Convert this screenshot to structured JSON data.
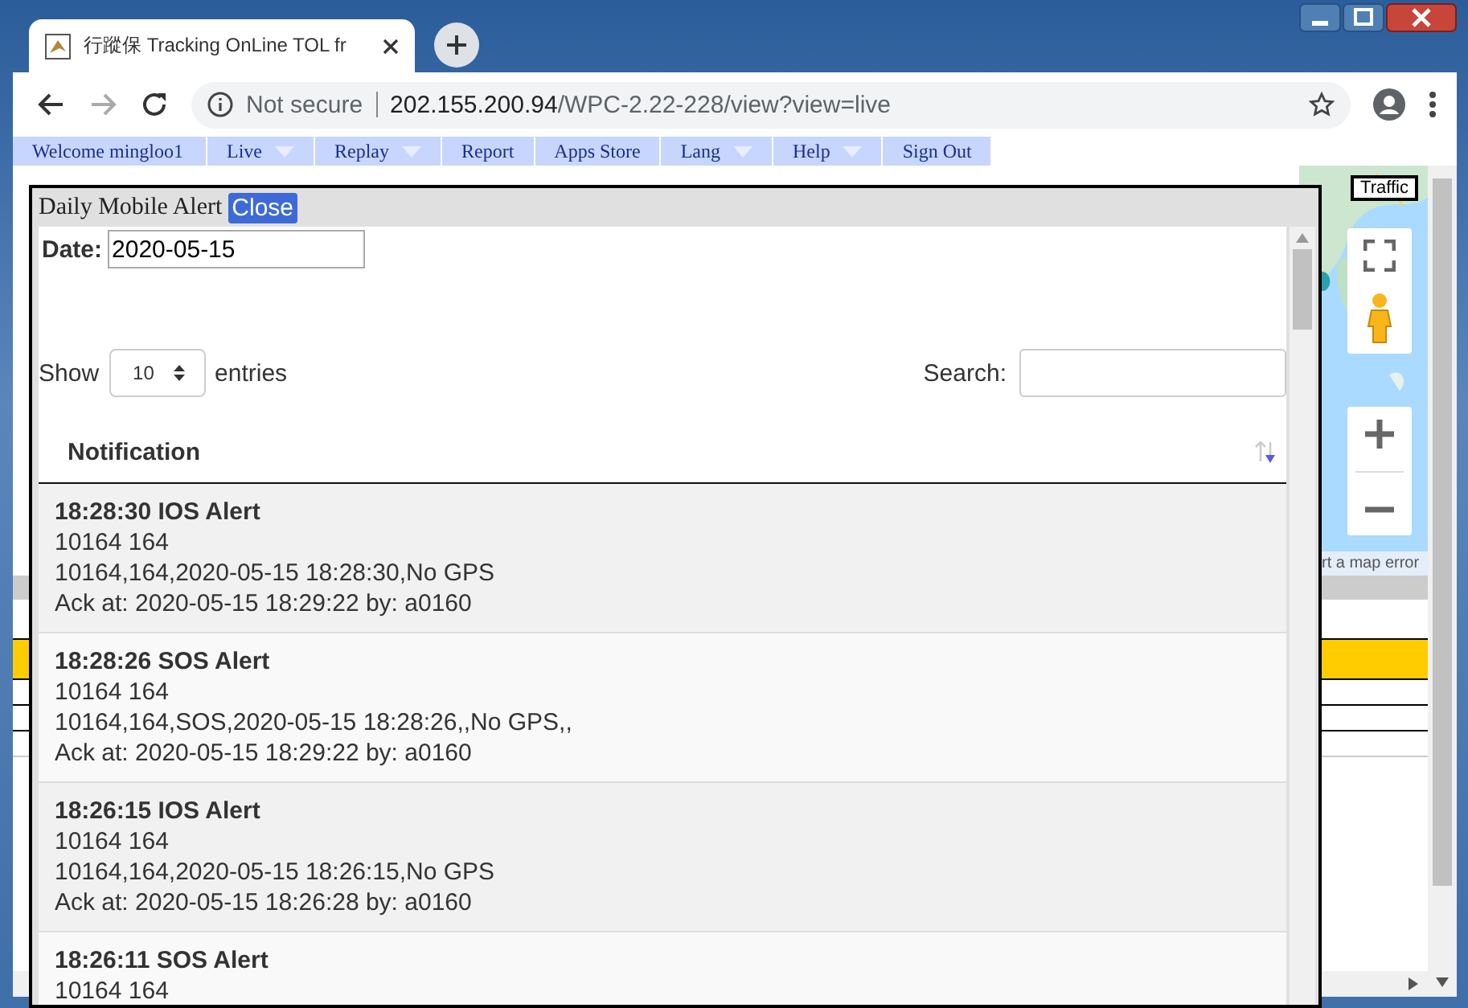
{
  "browser": {
    "tab_title": "行蹤保 Tracking OnLine TOL fr",
    "security": "Not secure",
    "url_host": "202.155.200.94",
    "url_path": "/WPC-2.22-228/view?view=live"
  },
  "menu": [
    {
      "label": "Welcome mingloo1",
      "dropdown": false
    },
    {
      "label": "Live",
      "dropdown": true
    },
    {
      "label": "Replay",
      "dropdown": true
    },
    {
      "label": "Report",
      "dropdown": false
    },
    {
      "label": "Apps Store",
      "dropdown": false
    },
    {
      "label": "Lang",
      "dropdown": true
    },
    {
      "label": "Help",
      "dropdown": true
    },
    {
      "label": "Sign Out",
      "dropdown": false
    }
  ],
  "map": {
    "traffic_label": "Traffic",
    "report_link": "rt a map error"
  },
  "modal": {
    "title": "Daily Mobile Alert",
    "close_label": "Close",
    "date_label": "Date:",
    "date_value": "2020-05-15",
    "show_label": "Show",
    "page_size": "10",
    "entries_label": "entries",
    "search_label": "Search:",
    "column": "Notification",
    "alerts": [
      {
        "title": "18:28:30 IOS Alert",
        "lines": [
          "10164 164",
          "10164,164,2020-05-15 18:28:30,No GPS",
          "Ack at: 2020-05-15 18:29:22 by: a0160"
        ]
      },
      {
        "title": "18:28:26 SOS Alert",
        "lines": [
          "10164 164",
          "10164,164,SOS,2020-05-15 18:28:26,,No GPS,,",
          "Ack at: 2020-05-15 18:29:22 by: a0160"
        ]
      },
      {
        "title": "18:26:15 IOS Alert",
        "lines": [
          "10164 164",
          "10164,164,2020-05-15 18:26:15,No GPS",
          "Ack at: 2020-05-15 18:26:28 by: a0160"
        ]
      },
      {
        "title": "18:26:11 SOS Alert",
        "lines": [
          "10164 164"
        ]
      }
    ]
  }
}
